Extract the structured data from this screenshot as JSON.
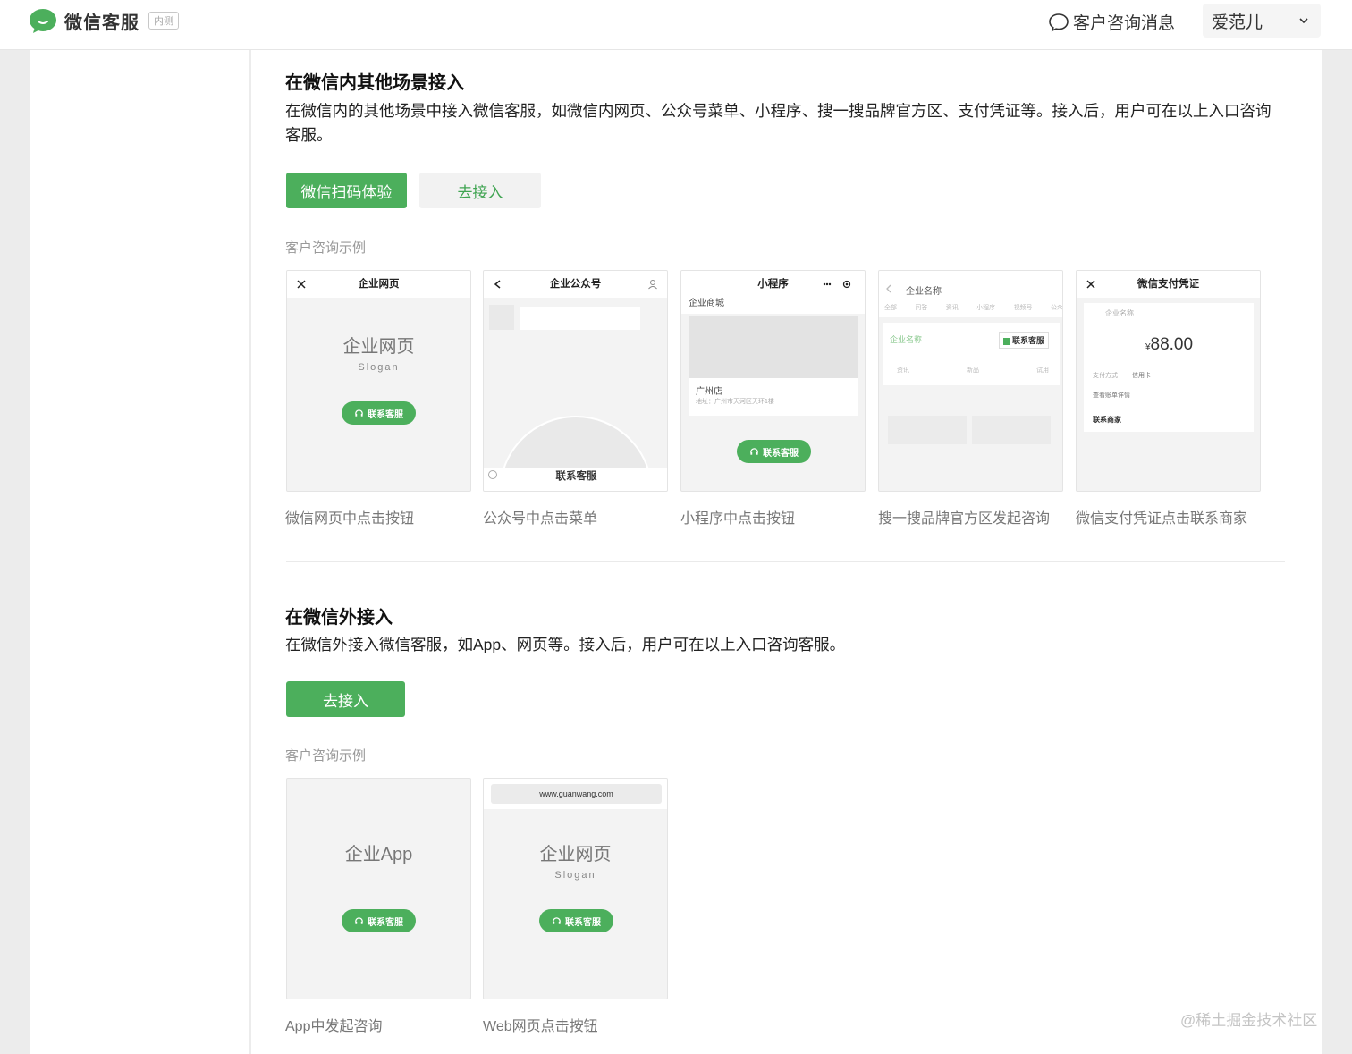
{
  "colors": {
    "accent": "#4caf5c",
    "accent_text": "#3fa451",
    "page_bg": "#ececec"
  },
  "header": {
    "brand": {
      "name": "微信客服",
      "badge": "内测",
      "logo_icon": "wechat-bubble-icon"
    },
    "messages_label": "客户咨询消息",
    "user_name": "爱范儿"
  },
  "section_in": {
    "title": "在微信内其他场景接入",
    "description": "在微信内的其他场景中接入微信客服，如微信内网页、公众号菜单、小程序、搜一搜品牌官方区、支付凭证等。接入后，用户可在以上入口咨询客服。",
    "scan_button": "微信扫码体验",
    "connect_button": "去接入",
    "examples_label": "客户咨询示例",
    "cards": [
      {
        "header": "企业网页",
        "big": "企业网页",
        "slogan": "Slogan",
        "pill": "联系客服",
        "caption": "微信网页中点击按钮"
      },
      {
        "header": "企业公众号",
        "menu_label": "联系客服",
        "caption": "公众号中点击菜单"
      },
      {
        "header": "小程序",
        "store": "企业商城",
        "shop_name": "广州店",
        "shop_addr": "地址：广州市天河区天环1楼",
        "pill": "联系客服",
        "caption": "小程序中点击按钮"
      },
      {
        "header": "企业名称",
        "tabs": [
          "全部",
          "问答",
          "资讯",
          "小程序",
          "视频号",
          "公众"
        ],
        "brand": "企业名称",
        "contact": "联系客服",
        "icons": [
          "资讯",
          "新品",
          "试用"
        ],
        "caption": "搜一搜品牌官方区发起咨询"
      },
      {
        "header": "微信支付凭证",
        "merchant": "企业名称",
        "amount": "88.00",
        "currency": "¥",
        "pay_method_label": "支付方式",
        "pay_method": "信用卡",
        "bill_detail": "查看账单详情",
        "contact_merchant": "联系商家",
        "caption": "微信支付凭证点击联系商家"
      }
    ]
  },
  "section_out": {
    "title": "在微信外接入",
    "description": "在微信外接入微信客服，如App、网页等。接入后，用户可在以上入口咨询客服。",
    "connect_button": "去接入",
    "examples_label": "客户咨询示例",
    "cards": [
      {
        "big": "企业App",
        "pill": "联系客服",
        "caption": "App中发起咨询"
      },
      {
        "url": "www.guanwang.com",
        "big": "企业网页",
        "slogan": "Slogan",
        "pill": "联系客服",
        "caption": "Web网页点击按钮"
      }
    ]
  },
  "watermark": "@稀土掘金技术社区"
}
